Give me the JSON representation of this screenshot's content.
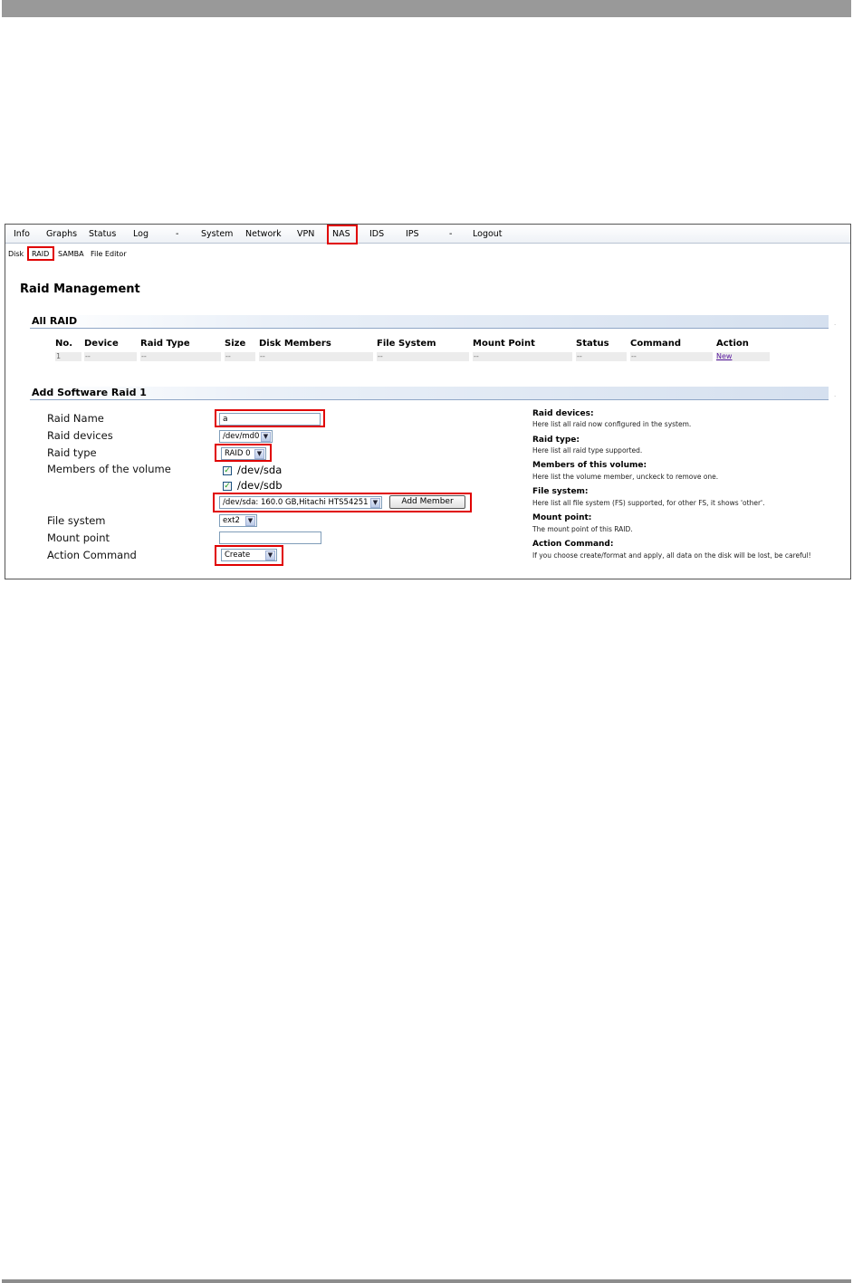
{
  "nav": {
    "items": [
      {
        "label": "Info"
      },
      {
        "label": "Graphs"
      },
      {
        "label": "Status"
      },
      {
        "label": "Log"
      },
      {
        "label": "-"
      },
      {
        "label": "System"
      },
      {
        "label": "Network"
      },
      {
        "label": "VPN"
      },
      {
        "label": "NAS"
      },
      {
        "label": "IDS"
      },
      {
        "label": "IPS"
      },
      {
        "label": "-"
      },
      {
        "label": "Logout"
      }
    ],
    "selected": "NAS"
  },
  "subnav": {
    "items": [
      {
        "label": "Disk"
      },
      {
        "label": "RAID"
      },
      {
        "label": "SAMBA"
      },
      {
        "label": "File Editor"
      }
    ],
    "selected": "RAID"
  },
  "page_title": "Raid Management",
  "all_raid": {
    "header": "All RAID",
    "columns": [
      "No.",
      "Device",
      "Raid Type",
      "Size",
      "Disk Members",
      "File System",
      "Mount Point",
      "Status",
      "Command",
      "Action"
    ],
    "rows": [
      [
        "1",
        "--",
        "--",
        "--",
        "--",
        "--",
        "--",
        "--",
        "--",
        "New"
      ]
    ]
  },
  "add_raid": {
    "header": "Add Software Raid 1",
    "labels": {
      "raid_name": "Raid Name",
      "raid_devices": "Raid devices",
      "raid_type": "Raid type",
      "members": "Members of the volume",
      "file_system": "File system",
      "mount_point": "Mount point",
      "action_command": "Action Command"
    },
    "values": {
      "raid_name": "a",
      "raid_devices": "/dev/md0",
      "raid_type": "RAID 0",
      "members": [
        {
          "label": "/dev/sda",
          "checked": true
        },
        {
          "label": "/dev/sdb",
          "checked": true
        }
      ],
      "member_select": "/dev/sda: 160.0 GB,Hitachi HTS54251",
      "add_member_button": "Add Member",
      "file_system": "ext2",
      "mount_point": "",
      "action_command": "Create"
    }
  },
  "help": [
    {
      "title": "Raid devices:",
      "text": "Here list all raid now configured in the system."
    },
    {
      "title": "Raid type:",
      "text": "Here list all raid type supported."
    },
    {
      "title": "Members of this volume:",
      "text": "Here list the volume member, unckeck to remove one."
    },
    {
      "title": "File system:",
      "text": "Here list all file system (FS) supported, for other FS, it shows 'other'."
    },
    {
      "title": "Mount point:",
      "text": "The mount point of this RAID."
    },
    {
      "title": "Action Command:",
      "text": "If you choose create/format and apply, all data on the disk will be lost, be careful!"
    }
  ],
  "colors": {
    "highlight": "#e00000",
    "nav_bg": "#eef1f6",
    "section_header": "#d5e0ef",
    "link": "#5a1aa0"
  }
}
